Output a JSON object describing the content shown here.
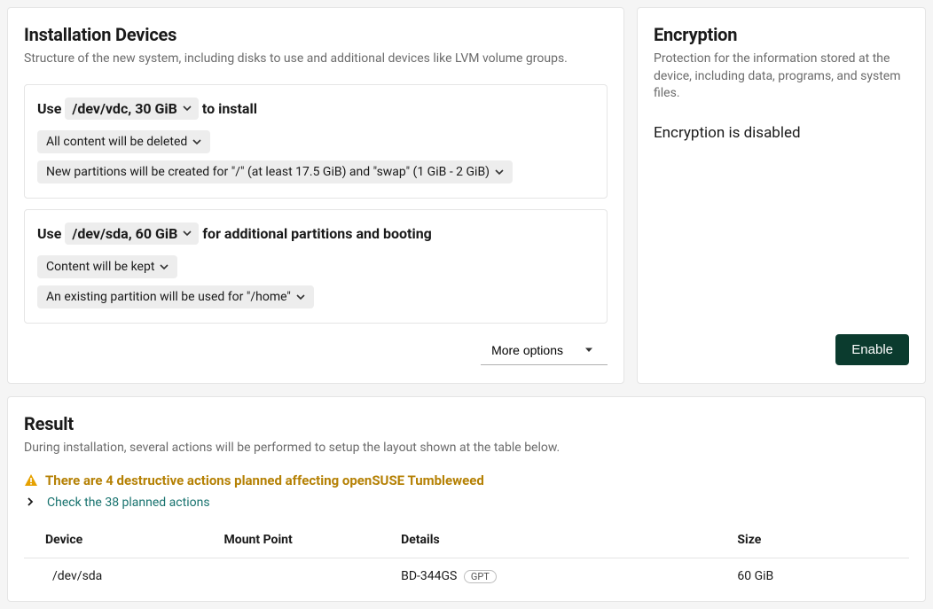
{
  "installation": {
    "title": "Installation Devices",
    "desc": "Structure of the new system, including disks to use and additional devices like LVM volume groups.",
    "devices": [
      {
        "use_label": "Use",
        "name": "/dev/vdc, 30 GiB",
        "suffix": "to install",
        "chips": [
          "All content will be deleted",
          "New partitions will be created for \"/\" (at least 17.5 GiB) and \"swap\" (1 GiB - 2 GiB)"
        ]
      },
      {
        "use_label": "Use",
        "name": "/dev/sda, 60 GiB",
        "suffix": "for additional partitions and booting",
        "chips": [
          "Content will be kept",
          "An existing partition will be used for \"/home\""
        ]
      }
    ],
    "more_options": "More options"
  },
  "encryption": {
    "title": "Encryption",
    "desc": "Protection for the information stored at the device, including data, programs, and system files.",
    "status": "Encryption is disabled",
    "enable_label": "Enable"
  },
  "result": {
    "title": "Result",
    "desc": "During installation, several actions will be performed to setup the layout shown at the table below.",
    "warning": "There are 4 destructive actions planned affecting openSUSE Tumbleweed",
    "check_link": "Check the 38 planned actions",
    "table": {
      "headers": {
        "device": "Device",
        "mount": "Mount Point",
        "details": "Details",
        "size": "Size"
      },
      "rows": [
        {
          "device": "/dev/sda",
          "mount": "",
          "details": "BD-344GS",
          "badge": "GPT",
          "size": "60 GiB"
        }
      ]
    }
  }
}
